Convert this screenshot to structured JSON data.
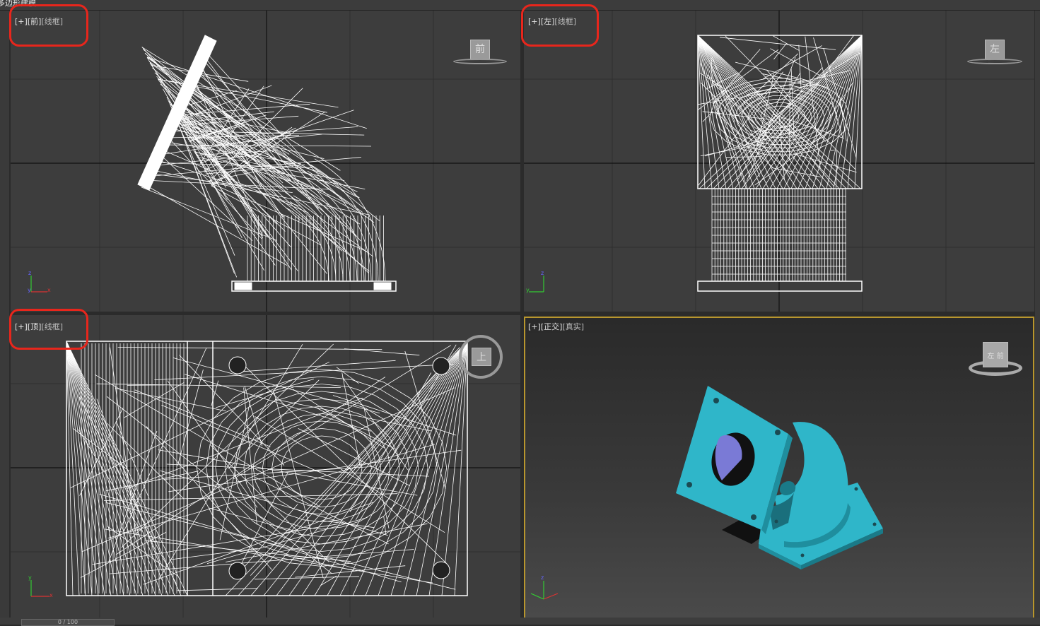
{
  "window": {
    "title": "多边形建模"
  },
  "viewports": {
    "front": {
      "plus": "[+]",
      "view": "[前]",
      "mode": "[线框]",
      "cube_label": "前"
    },
    "left": {
      "plus": "[+]",
      "view": "[左]",
      "mode": "[线框]",
      "cube_label": "左"
    },
    "top": {
      "plus": "[+]",
      "view": "[顶]",
      "mode": "[线框]",
      "cube_label": "上"
    },
    "perspective": {
      "plus": "[+]",
      "view": "[正交]",
      "mode": "[真实]",
      "cube_label": "左 前"
    }
  },
  "timeline": {
    "frame_text": "0 / 100"
  },
  "colors": {
    "highlight": "#e8261c",
    "active_border": "#b8962e",
    "model_shaded": "#2fb6c9",
    "wireframe": "#ffffff",
    "viewport_bg": "#3d3d3d"
  },
  "icons": [
    "axis-gizmo-icon",
    "viewcube-icon"
  ]
}
